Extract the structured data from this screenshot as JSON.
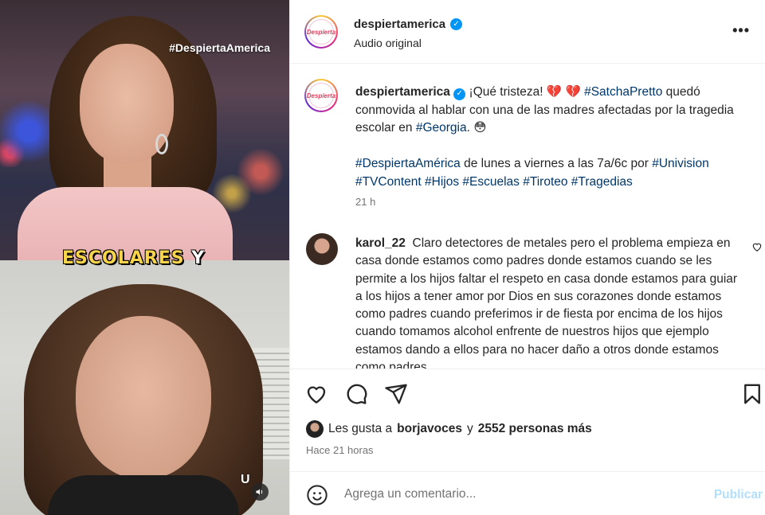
{
  "media": {
    "overlay_hashtag": "#DespiertaAmerica",
    "caption_word": "ESCOLARES",
    "caption_word2": "Y",
    "logo_mark": "U"
  },
  "header": {
    "avatar_text": "Despierta",
    "username": "despiertamerica",
    "audio": "Audio original",
    "more": "•••"
  },
  "caption": {
    "username": "despiertamerica",
    "text_1": "¡Qué tristeza! 💔 💔 ",
    "tag_satcha": "#SatchaPretto",
    "text_2": " quedó conmovida al hablar con una de las madres afectadas por la tragedia escolar en ",
    "tag_georgia": "#Georgia",
    "text_3": ". 😳",
    "tag_despierta": "#DespiertaAmérica",
    "text_4": " de lunes a viernes a las 7a/6c por ",
    "tag_univision": "#Univision",
    "tags_line": "#TVContent #Hijos #Escuelas #Tiroteo #Tragedias",
    "time": "21 h"
  },
  "comment": {
    "username": "karol_22",
    "text": "Claro detectores de metales pero el problema empieza en casa donde estamos como padres donde estamos cuando se les permite a los hijos faltar el respeto en casa donde estamos para guiar a los hijos a tener amor por Dios en sus corazones donde estamos como padres cuando preferimos ir de fiesta por encima de los hijos cuando tomamos alcohol enfrente de nuestros hijos que ejemplo estamos dando a ellos para no hacer daño a otros donde estamos como padres"
  },
  "likes": {
    "prefix": "Les gusta a",
    "user": "borjavoces",
    "conj": "y",
    "count_text": "2552 personas más"
  },
  "post_time": "Hace 21 horas",
  "add_comment": {
    "placeholder": "Agrega un comentario...",
    "publish": "Publicar"
  },
  "colors": {
    "link": "#00376b",
    "verified": "#0095f6",
    "publish_disabled": "#b2dffc"
  }
}
